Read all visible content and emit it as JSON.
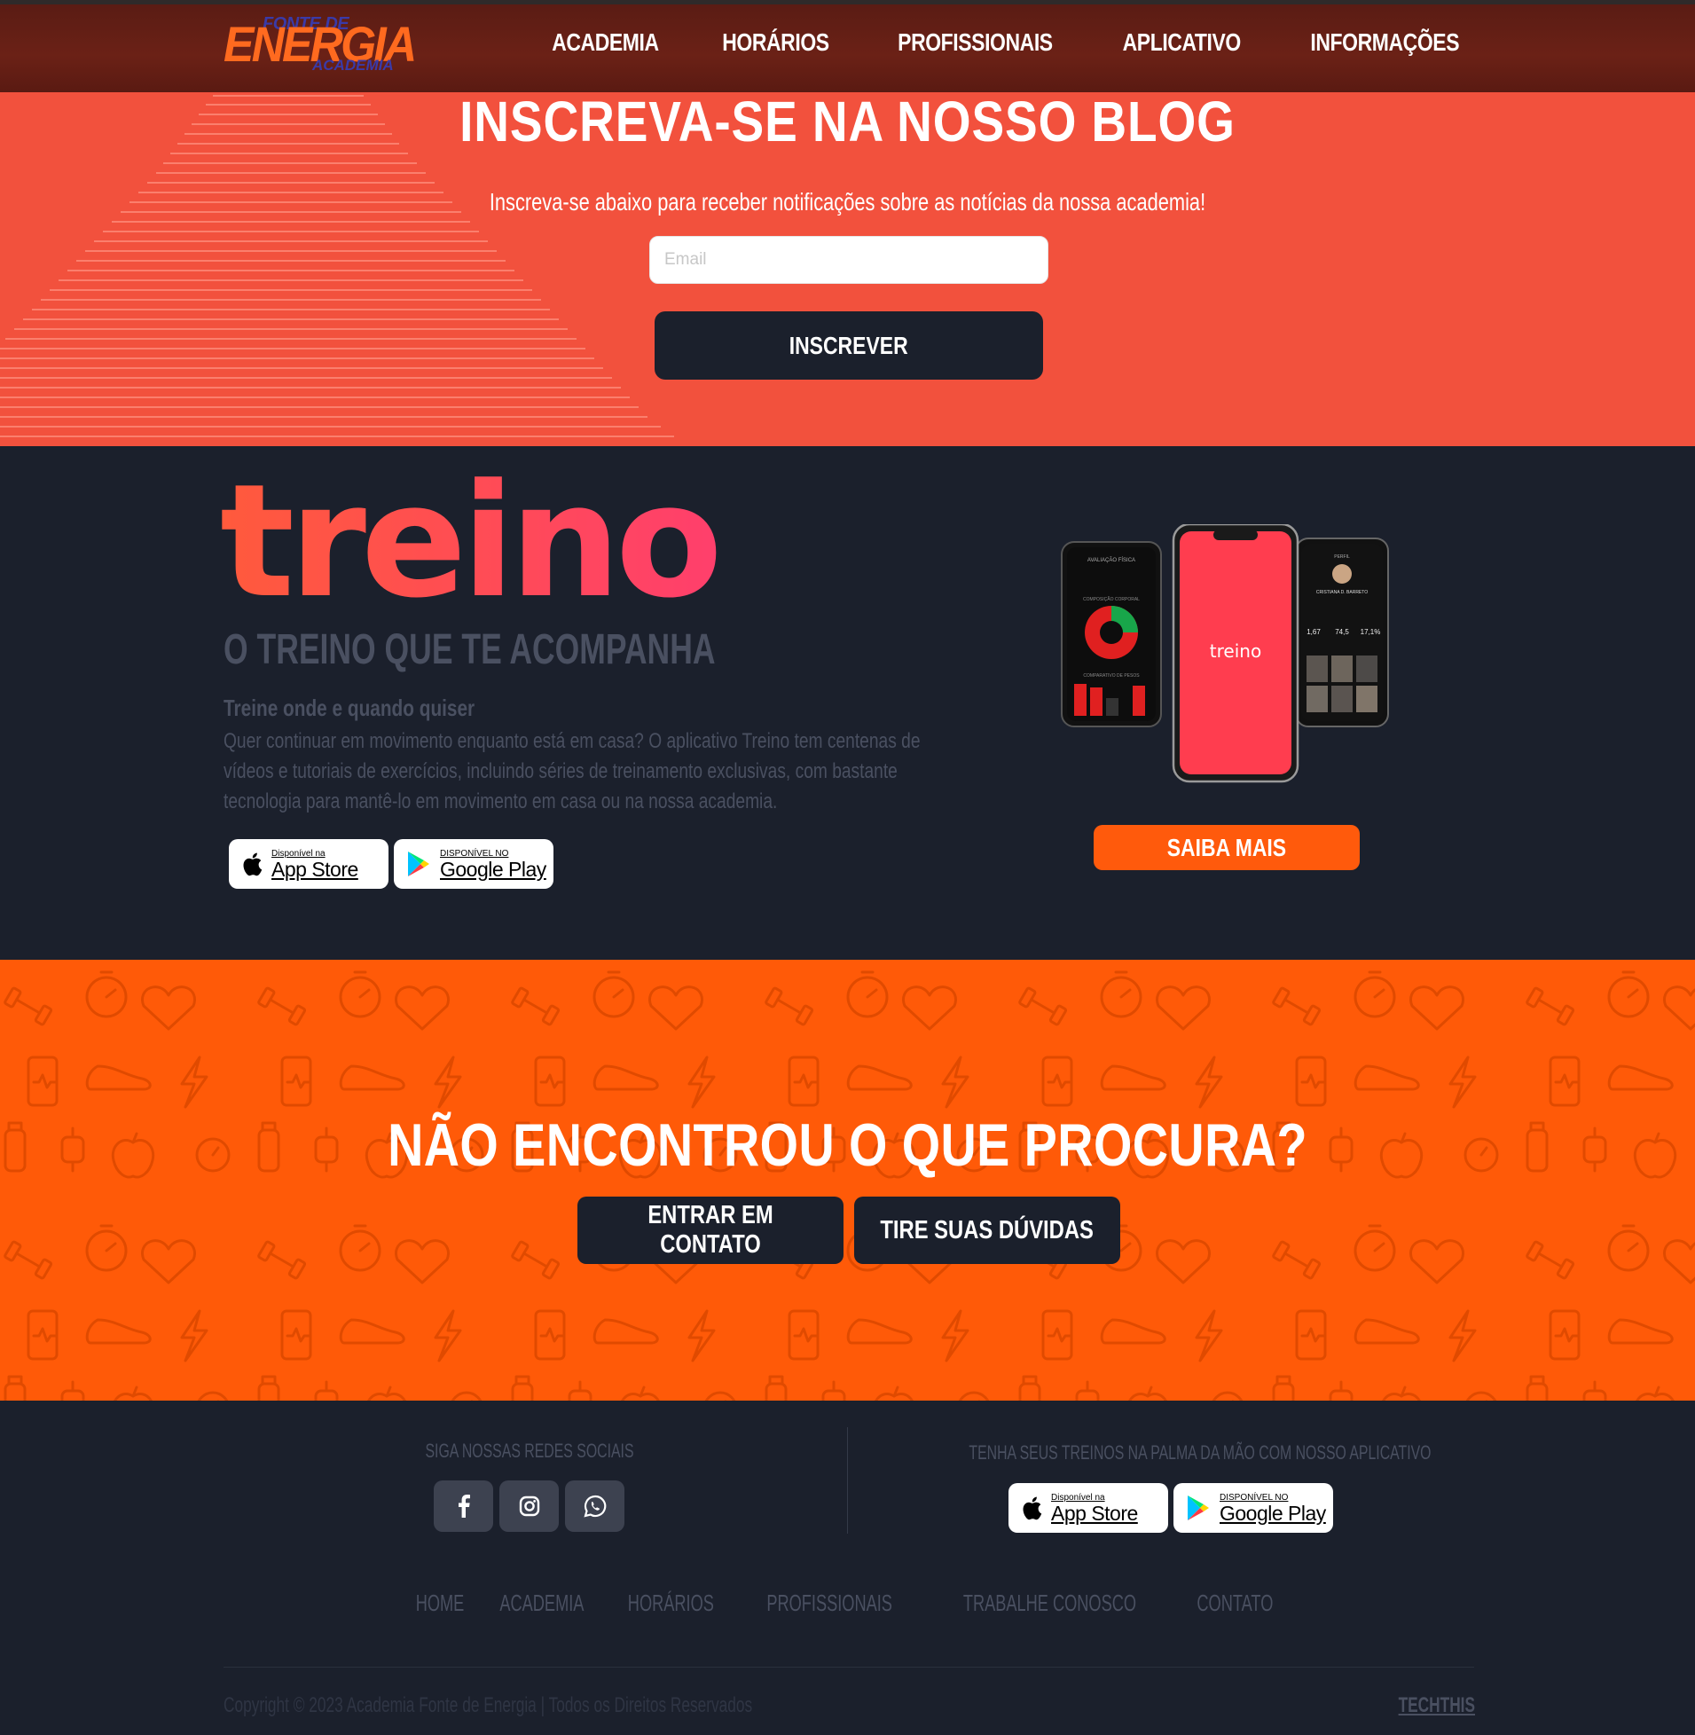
{
  "nav": {
    "logo": {
      "line1": "FONTE DE",
      "line2": "ENERGIA",
      "line3": "ACADEMIA"
    },
    "items": [
      {
        "label": "ACADEMIA"
      },
      {
        "label": "HORÁRIOS"
      },
      {
        "label": "PROFISSIONAIS"
      },
      {
        "label": "APLICATIVO"
      },
      {
        "label": "INFORMAÇÕES"
      }
    ]
  },
  "blog": {
    "title": "INSCREVA-SE NA NOSSO BLOG",
    "subtitle": "Inscreva-se abaixo para receber notificações sobre as notícias da nossa academia!",
    "email_placeholder": "Email",
    "email_value": "",
    "submit_label": "INSCREVER"
  },
  "app": {
    "logo_text": "treino",
    "tagline": "O TREINO QUE TE ACOMPANHA",
    "feature_title": "Treine onde e quando quiser",
    "feature_desc": "Quer continuar em movimento enquanto está em casa? O aplicativo Treino tem centenas de vídeos e tutoriais de exercícios, incluindo séries de treinamento exclusivas, com bastante tecnologia para mantê-lo em movimento em casa ou na nossa academia.",
    "appstore": {
      "small": "Disponível na",
      "big": "App Store"
    },
    "googleplay": {
      "small": "DISPONÍVEL NO",
      "big": "Google Play"
    },
    "saiba_label": "SAIBA MAIS",
    "phone_screen_label": "treino",
    "phone_left": {
      "header": "AVALIAÇÃO FÍSICA",
      "chart1": "COMPOSIÇÃO CORPORAL",
      "chart2": "COMPARATIVO DE PESOS"
    },
    "phone_right": {
      "header": "PERFIL",
      "name": "CRISTIANA D. BARRETO",
      "stats": [
        "1,67",
        "74,5",
        "17,1%"
      ]
    }
  },
  "cta": {
    "title": "NÃO ENCONTROU O QUE PROCURA?",
    "contact_label": "ENTRAR EM CONTATO",
    "faq_label": "TIRE SUAS DÚVIDAS"
  },
  "footer": {
    "social_title": "SIGA NOSSAS REDES SOCIAIS",
    "social": [
      {
        "icon": "facebook-icon"
      },
      {
        "icon": "instagram-icon"
      },
      {
        "icon": "whatsapp-icon"
      }
    ],
    "app_title": "TENHA SEUS TREINOS NA PALMA DA MÃO COM NOSSO APLICATIVO",
    "appstore": {
      "small": "Disponível na",
      "big": "App Store"
    },
    "googleplay": {
      "small": "DISPONÍVEL NO",
      "big": "Google Play"
    },
    "links": [
      {
        "label": "HOME"
      },
      {
        "label": "ACADEMIA"
      },
      {
        "label": "HORÁRIOS"
      },
      {
        "label": "PROFISSIONAIS"
      },
      {
        "label": "TRABALHE CONOSCO"
      },
      {
        "label": "CONTATO"
      }
    ],
    "copyright": "Copyright © 2023 Academia Fonte de Energia | Todos os Direitos Reservados",
    "credit": "TECHTHIS"
  },
  "colors": {
    "blog_bg": "#f2513d",
    "dark_bg": "#1b202c",
    "cta_bg": "#ff5a08",
    "accent": "#ff5a0c"
  }
}
